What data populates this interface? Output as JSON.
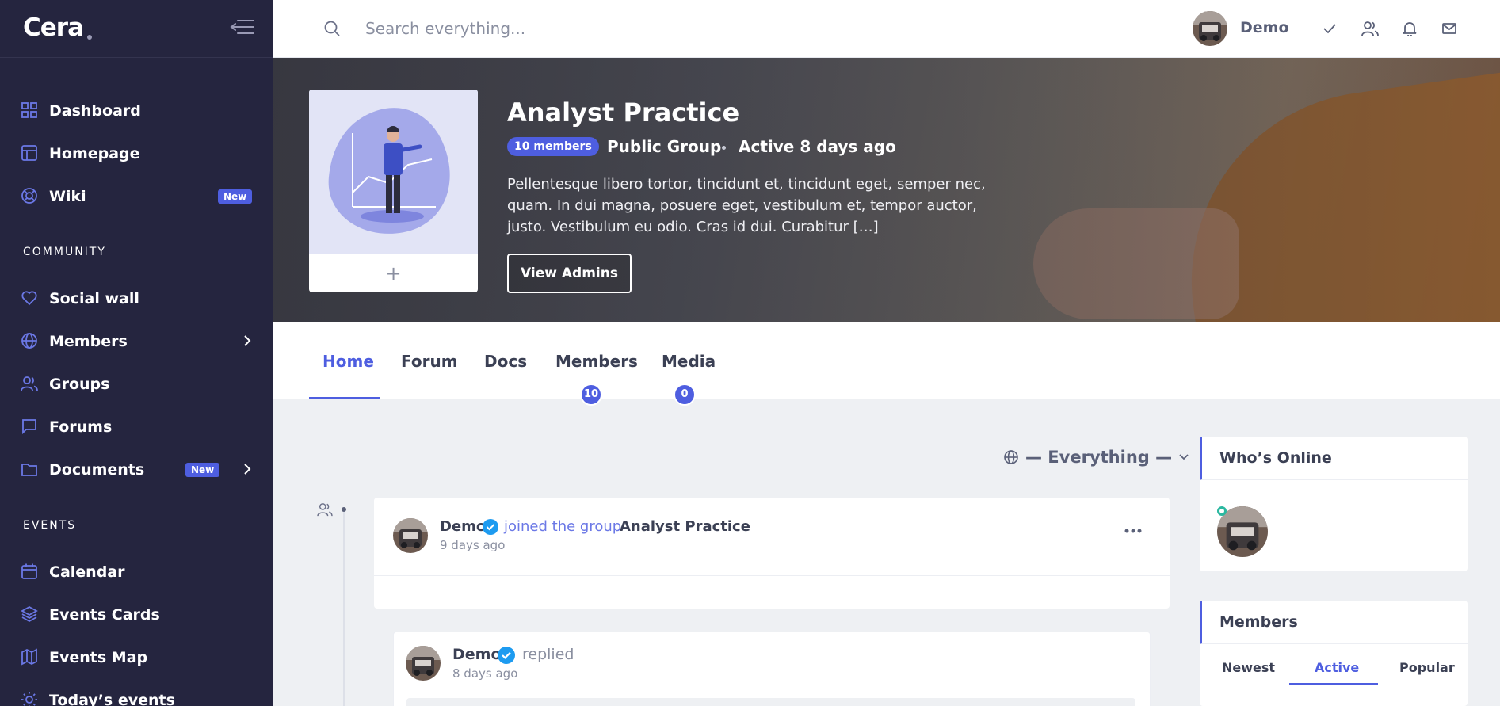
{
  "brand": {
    "name": "Cera"
  },
  "sidebar": {
    "items": [
      {
        "label": "Dashboard",
        "icon": "grid-icon"
      },
      {
        "label": "Homepage",
        "icon": "layout-icon"
      },
      {
        "label": "Wiki",
        "icon": "lifebuoy-icon",
        "badge": "New"
      }
    ],
    "community_title": "COMMUNITY",
    "community": [
      {
        "label": "Social wall",
        "icon": "heart-icon"
      },
      {
        "label": "Members",
        "icon": "globe-icon"
      },
      {
        "label": "Groups",
        "icon": "users-icon"
      },
      {
        "label": "Forums",
        "icon": "message-square-icon"
      },
      {
        "label": "Documents",
        "icon": "folder-icon",
        "badge": "New"
      }
    ],
    "events_title": "EVENTS",
    "events": [
      {
        "label": "Calendar",
        "icon": "calendar-icon"
      },
      {
        "label": "Events Cards",
        "icon": "layers-icon"
      },
      {
        "label": "Events Map",
        "icon": "map-icon"
      },
      {
        "label": "Today’s events",
        "icon": "sun-icon"
      }
    ]
  },
  "topbar": {
    "search_placeholder": "Search everything...",
    "user_name": "Demo"
  },
  "group": {
    "title": "Analyst Practice",
    "members_badge": "10 members",
    "type": "Public Group",
    "active": "Active 8 days ago",
    "description": "Pellentesque libero tortor, tincidunt et, tincidunt eget, semper nec, quam. In dui magna, posuere eget, vestibulum et, tempor auctor, justo. Vestibulum eu odio. Cras id dui. Curabitur […]",
    "view_admins": "View Admins",
    "photo_add": "+"
  },
  "tabs": [
    {
      "label": "Home"
    },
    {
      "label": "Forum"
    },
    {
      "label": "Docs"
    },
    {
      "label": "Members",
      "count": "10"
    },
    {
      "label": "Media",
      "count": "0"
    }
  ],
  "feed": {
    "filter": "— Everything —",
    "post1": {
      "author": "Demo",
      "action": "joined the group",
      "target": "Analyst Practice",
      "time": "9 days ago"
    },
    "post2": {
      "author": "Demo",
      "action": "replied",
      "time": "8 days ago"
    }
  },
  "widgets": {
    "online_title": "Who’s Online",
    "members_title": "Members",
    "members_tabs": [
      "Newest",
      "Active",
      "Popular"
    ]
  },
  "colors": {
    "accent": "#4e5ee0",
    "sidebar": "#25253f",
    "online": "#2bb8a0"
  }
}
